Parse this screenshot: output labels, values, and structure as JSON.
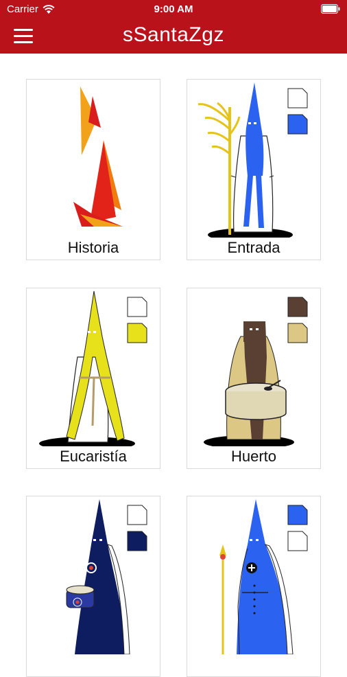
{
  "status_bar": {
    "carrier": "Carrier",
    "time": "9:00 AM"
  },
  "header": {
    "title": "sSantaZgz"
  },
  "cards": [
    {
      "label": "Historia",
      "colors": []
    },
    {
      "label": "Entrada",
      "colors": [
        "#ffffff",
        "#2b62f0"
      ]
    },
    {
      "label": "Eucaristía",
      "colors": [
        "#ffffff",
        "#e6e11a"
      ]
    },
    {
      "label": "Huerto",
      "colors": [
        "#5a4032",
        "#dcc884"
      ]
    },
    {
      "label": "",
      "colors": [
        "#ffffff",
        "#0d1d5f"
      ]
    },
    {
      "label": "",
      "colors": [
        "#2b62f0",
        "#ffffff"
      ]
    }
  ],
  "theme": {
    "header_bg": "#b9121b"
  }
}
